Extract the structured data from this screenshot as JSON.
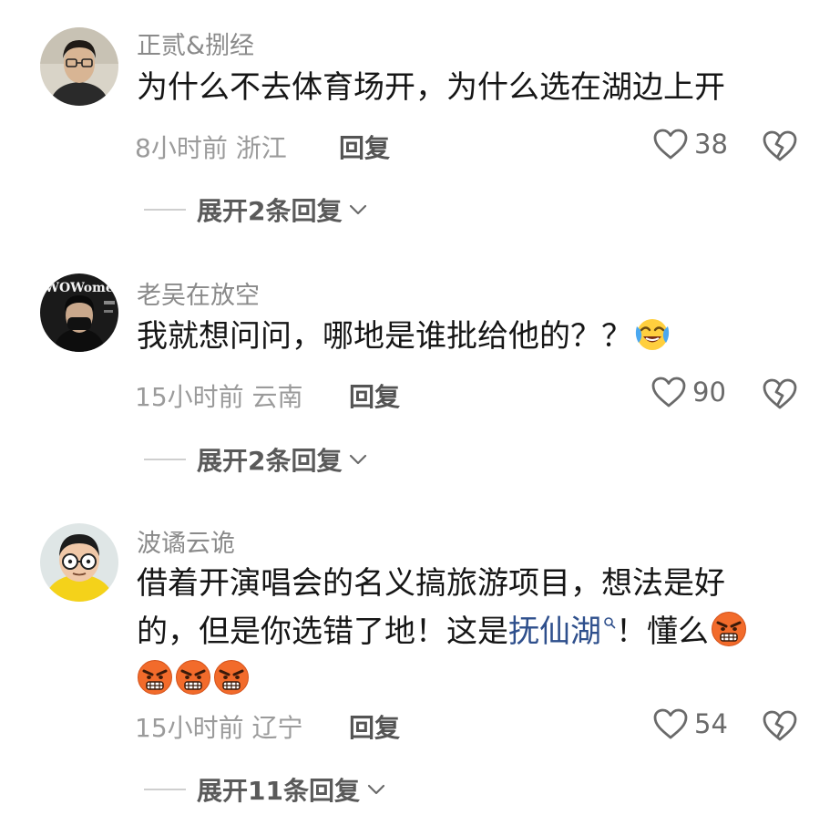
{
  "comments": [
    {
      "username": "正贰&捌经",
      "text_parts": [
        "为什么不去体育场开，为什么选在湖边上开"
      ],
      "time": "8小时前",
      "location": "浙江",
      "reply_label": "回复",
      "likes": "38",
      "expand_label": "展开2条回复"
    },
    {
      "username": "老吴在放空",
      "text_parts": [
        "我就想问问，哪地是谁批给他的？？"
      ],
      "emoji": "crying-laughing-emoji",
      "time": "15小时前",
      "location": "云南",
      "reply_label": "回复",
      "likes": "90",
      "expand_label": "展开2条回复",
      "avatar_text": "WOWome"
    },
    {
      "username": "波谲云诡",
      "text_line1": "借着开演唱会的名义搞旅游项目，想法是好",
      "text_line2_before": "的，但是你选错了地！这是",
      "link_text": "抚仙湖",
      "text_line2_after": "！懂么",
      "emoji": "angry-face-emoji",
      "emoji_count": 4,
      "time": "15小时前",
      "location": "辽宁",
      "reply_label": "回复",
      "likes": "54",
      "expand_label": "展开11条回复"
    }
  ],
  "colors": {
    "username": "#8a8a8a",
    "text": "#161616",
    "link": "#2e4f8c",
    "meta": "#9b9b9b"
  }
}
